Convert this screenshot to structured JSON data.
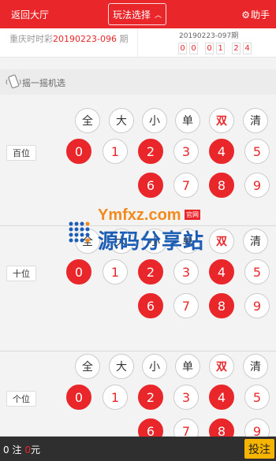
{
  "header": {
    "back_label": "返回大厅",
    "play_select_label": "玩法选择",
    "helper_label": "助手"
  },
  "issue": {
    "lottery_name": "重庆时时彩",
    "current_issue": "20190223-096",
    "issue_suffix": "期",
    "next_issue": "20190223-097",
    "next_issue_suffix": "期",
    "countdown_digits": [
      "0",
      "0",
      "0",
      "1",
      "2",
      "4"
    ]
  },
  "shake": {
    "label": "摇一摇机选"
  },
  "quick_select": [
    "全",
    "大",
    "小",
    "单",
    "双",
    "清"
  ],
  "sections": [
    {
      "label": "百位",
      "balls": [
        {
          "num": "0",
          "selected": true
        },
        {
          "num": "1",
          "selected": false
        },
        {
          "num": "2",
          "selected": true
        },
        {
          "num": "3",
          "selected": false
        },
        {
          "num": "4",
          "selected": true
        },
        {
          "num": "5",
          "selected": false
        },
        {
          "num": "6",
          "selected": true
        },
        {
          "num": "7",
          "selected": false
        },
        {
          "num": "8",
          "selected": true
        },
        {
          "num": "9",
          "selected": false
        }
      ]
    },
    {
      "label": "十位",
      "balls": [
        {
          "num": "0",
          "selected": true
        },
        {
          "num": "1",
          "selected": false
        },
        {
          "num": "2",
          "selected": true
        },
        {
          "num": "3",
          "selected": false
        },
        {
          "num": "4",
          "selected": true
        },
        {
          "num": "5",
          "selected": false
        },
        {
          "num": "6",
          "selected": true
        },
        {
          "num": "7",
          "selected": false
        },
        {
          "num": "8",
          "selected": true
        },
        {
          "num": "9",
          "selected": false
        }
      ]
    },
    {
      "label": "个位",
      "balls": [
        {
          "num": "0",
          "selected": true
        },
        {
          "num": "1",
          "selected": false
        },
        {
          "num": "2",
          "selected": true
        },
        {
          "num": "3",
          "selected": false
        },
        {
          "num": "4",
          "selected": true
        },
        {
          "num": "5",
          "selected": false
        },
        {
          "num": "6",
          "selected": true
        },
        {
          "num": "7",
          "selected": false
        },
        {
          "num": "8",
          "selected": true
        },
        {
          "num": "9",
          "selected": false
        }
      ]
    }
  ],
  "watermark": {
    "url": "Ymfxz.com",
    "tag": "官网",
    "name": "源码分享站"
  },
  "footer": {
    "bet_count": "0",
    "bet_unit": "注",
    "amount": "0",
    "amount_unit": "元",
    "bet_button": "投注"
  },
  "colors": {
    "accent": "#e9262a",
    "bet_button": "#f5b400",
    "footer_bg": "#2f2f2f"
  }
}
